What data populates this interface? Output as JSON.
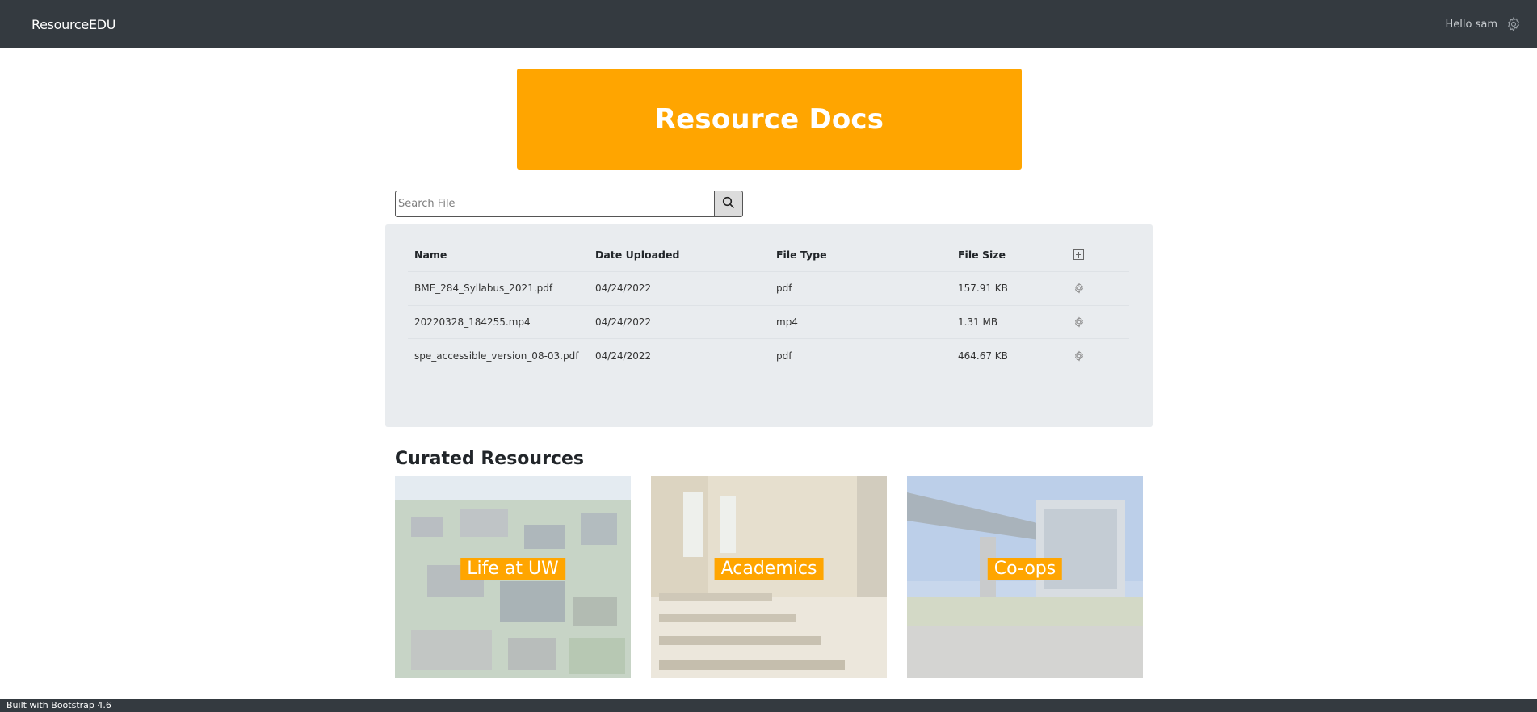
{
  "navbar": {
    "brand": "ResourceEDU",
    "greeting": "Hello sam",
    "settings_icon": "gear-icon"
  },
  "hero": {
    "title": "Resource Docs",
    "color": "#ffa500"
  },
  "search": {
    "placeholder": "Search File",
    "value": "",
    "button_icon": "search-icon"
  },
  "files": {
    "columns": [
      "Name",
      "Date Uploaded",
      "File Type",
      "File Size"
    ],
    "add_icon": "plus-square-icon",
    "rows": [
      {
        "name": "BME_284_Syllabus_2021.pdf",
        "date": "04/24/2022",
        "type": "pdf",
        "size": "157.91 KB",
        "action_icon": "gear-icon"
      },
      {
        "name": "20220328_184255.mp4",
        "date": "04/24/2022",
        "type": "mp4",
        "size": "1.31 MB",
        "action_icon": "gear-icon"
      },
      {
        "name": "spe_accessible_version_08-03.pdf",
        "date": "04/24/2022",
        "type": "pdf",
        "size": "464.67 KB",
        "action_icon": "gear-icon"
      }
    ]
  },
  "curated": {
    "title": "Curated Resources",
    "cards": [
      {
        "label": "Life at UW"
      },
      {
        "label": "Academics"
      },
      {
        "label": "Co-ops"
      }
    ]
  },
  "footer": {
    "text": "Built with Bootstrap 4.6"
  }
}
